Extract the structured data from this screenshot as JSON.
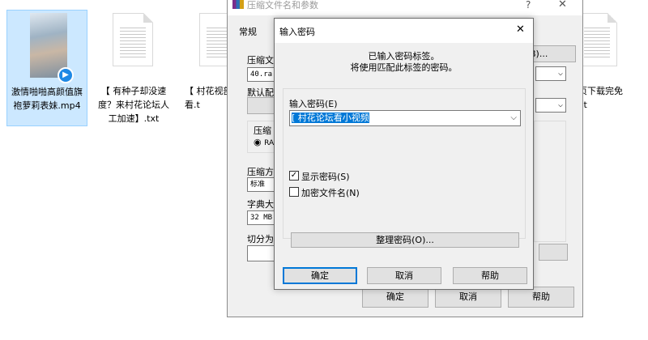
{
  "desktop": {
    "files": [
      {
        "name": "激情啪啪高颜值旗袍萝莉表妹.mp4"
      },
      {
        "name": "【 有种子却没速度？来村花论坛人工加速】.txt"
      },
      {
        "name": "【 村花视部视频免看.t"
      },
      {
        "name": "页下载完免\nxt"
      }
    ]
  },
  "main_dialog": {
    "title": "压缩文件名和参数",
    "help_glyph": "?",
    "close_glyph": "✕",
    "tab_general": "常规",
    "archive_name_label": "压缩文",
    "archive_name_value": "40.ra",
    "browse_label": "B)...",
    "default_profile_label": "默认配",
    "compress_format_label": "压缩",
    "format_rar_label": "RA",
    "method_label": "压缩方",
    "method_value": "标准",
    "dict_label": "字典大",
    "dict_value": "32 MB",
    "split_label": "切分为",
    "ok": "确定",
    "cancel": "取消",
    "help": "帮助"
  },
  "password_dialog": {
    "title": "输入密码",
    "close_glyph": "✕",
    "info_line1": "已输入密码标签。",
    "info_line2": "将使用匹配此标签的密码。",
    "password_label": "输入密码(E)",
    "password_value": "[ 村花论坛看小视频",
    "show_password_label": "显示密码(S)",
    "show_password_checked": true,
    "encrypt_names_label": "加密文件名(N)",
    "encrypt_names_checked": false,
    "organize_button": "整理密码(O)...",
    "ok": "确定",
    "cancel": "取消",
    "help": "帮助"
  }
}
